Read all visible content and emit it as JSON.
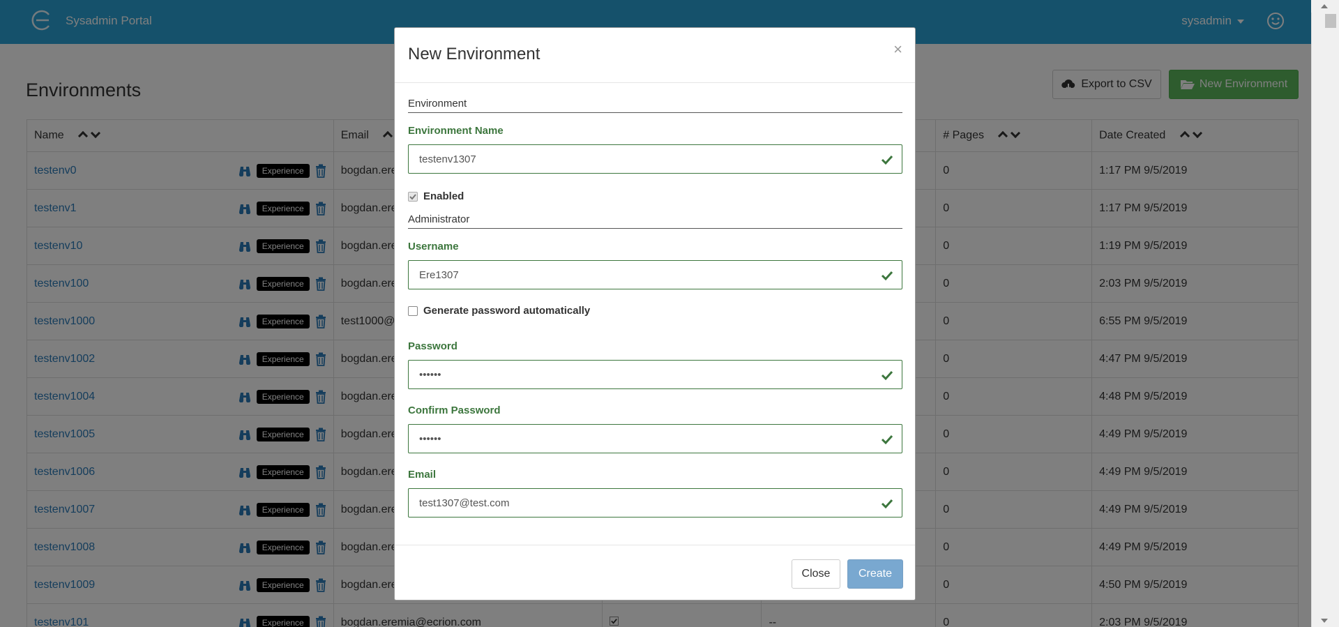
{
  "header": {
    "brand": "Sysadmin Portal",
    "user": "sysadmin"
  },
  "page": {
    "title": "Environments",
    "export_label": "Export to CSV",
    "new_label": "New Environment"
  },
  "table": {
    "columns": {
      "name": "Name",
      "email": "Email",
      "pages": "# Pages",
      "date": "Date Created"
    },
    "badge": "Experience",
    "rows": [
      {
        "name": "testenv0",
        "email": "bogdan.ere",
        "pages": "0",
        "date": "1:17 PM 9/5/2019"
      },
      {
        "name": "testenv1",
        "email": "bogdan.ere",
        "pages": "0",
        "date": "1:17 PM 9/5/2019"
      },
      {
        "name": "testenv10",
        "email": "bogdan.ere",
        "pages": "0",
        "date": "1:19 PM 9/5/2019"
      },
      {
        "name": "testenv100",
        "email": "bogdan.ere",
        "pages": "0",
        "date": "2:03 PM 9/5/2019"
      },
      {
        "name": "testenv1000",
        "email": "test1000@",
        "pages": "0",
        "date": "6:55 PM 9/5/2019"
      },
      {
        "name": "testenv1002",
        "email": "bogdan.ere",
        "pages": "0",
        "date": "4:47 PM 9/5/2019"
      },
      {
        "name": "testenv1004",
        "email": "bogdan.ere",
        "pages": "0",
        "date": "4:48 PM 9/5/2019"
      },
      {
        "name": "testenv1005",
        "email": "bogdan.ere",
        "pages": "0",
        "date": "4:49 PM 9/5/2019"
      },
      {
        "name": "testenv1006",
        "email": "bogdan.ere",
        "pages": "0",
        "date": "4:49 PM 9/5/2019"
      },
      {
        "name": "testenv1007",
        "email": "bogdan.ere",
        "pages": "0",
        "date": "4:49 PM 9/5/2019"
      },
      {
        "name": "testenv1008",
        "email": "bogdan.ere",
        "pages": "0",
        "date": "4:49 PM 9/5/2019"
      },
      {
        "name": "testenv1009",
        "email": "bogdan.ere",
        "pages": "0",
        "date": "4:50 PM 9/5/2019"
      },
      {
        "name": "testenv101",
        "email": "bogdan.eremia@ecrion.com",
        "extra": "--",
        "pages": "0",
        "date": "2:03 PM 9/5/2019"
      }
    ]
  },
  "modal": {
    "title": "New Environment",
    "close_x": "×",
    "section_environment": "Environment",
    "env_name_label": "Environment Name",
    "env_name_value": "testenv1307",
    "enabled_label": "Enabled",
    "section_admin": "Administrator",
    "username_label": "Username",
    "username_value": "Ere1307",
    "genpass_label": "Generate password automatically",
    "password_label": "Password",
    "password_value": "••••••",
    "confirm_label": "Confirm Password",
    "confirm_value": "••••••",
    "email_label": "Email",
    "email_value": "test1307@test.com",
    "btn_close": "Close",
    "btn_create": "Create"
  },
  "colors": {
    "topbar": "#2aa3d6",
    "success": "#3c763d",
    "primary": "#337ab7",
    "green_button": "#5cb85c"
  }
}
